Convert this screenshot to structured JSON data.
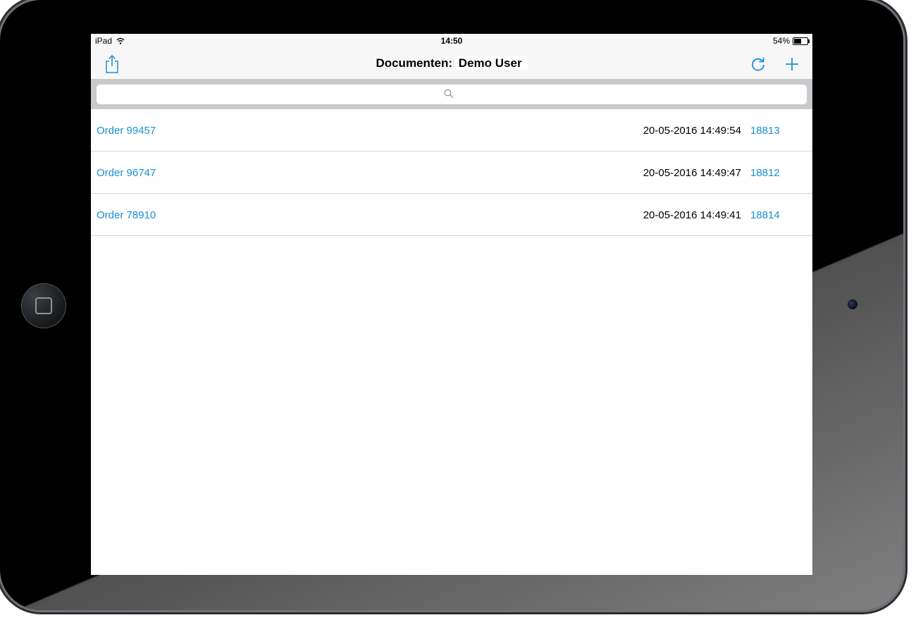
{
  "status_bar": {
    "carrier": "iPad",
    "time": "14:50",
    "battery_percent_label": "54%",
    "battery_level": 0.54,
    "wifi_icon": "wifi-icon"
  },
  "nav_bar": {
    "title_prefix": "Documenten:",
    "title_user": "Demo User",
    "share_icon": "share-icon",
    "refresh_icon": "refresh-icon",
    "add_icon": "plus-icon",
    "accent_color": "#1a8fd6"
  },
  "search": {
    "placeholder": "",
    "value": ""
  },
  "documents": [
    {
      "name": "Order 99457",
      "date": "20-05-2016 14:49:54",
      "id": "18813"
    },
    {
      "name": "Order 96747",
      "date": "20-05-2016 14:49:47",
      "id": "18812"
    },
    {
      "name": "Order 78910",
      "date": "20-05-2016 14:49:41",
      "id": "18814"
    }
  ]
}
